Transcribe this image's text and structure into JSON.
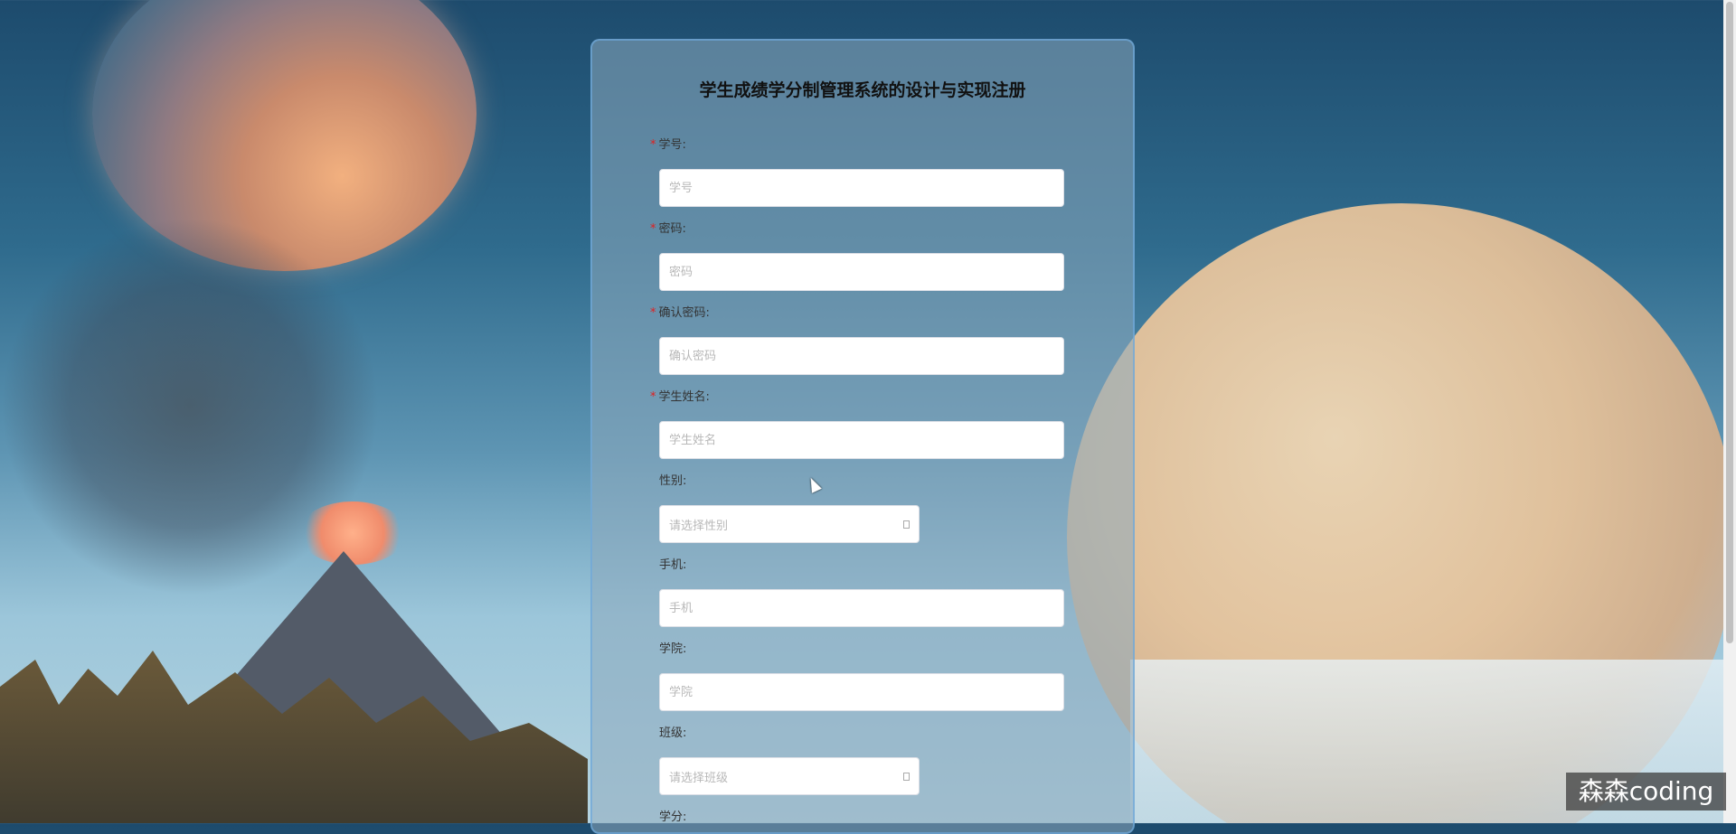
{
  "form": {
    "title": "学生成绩学分制管理系统的设计与实现注册",
    "fields": [
      {
        "label": "学号:",
        "required": true,
        "type": "text",
        "placeholder": "学号"
      },
      {
        "label": "密码:",
        "required": true,
        "type": "password",
        "placeholder": "密码"
      },
      {
        "label": "确认密码:",
        "required": true,
        "type": "password",
        "placeholder": "确认密码"
      },
      {
        "label": "学生姓名:",
        "required": true,
        "type": "text",
        "placeholder": "学生姓名"
      },
      {
        "label": "性别:",
        "required": false,
        "type": "select",
        "placeholder": "请选择性别"
      },
      {
        "label": "手机:",
        "required": false,
        "type": "text",
        "placeholder": "手机"
      },
      {
        "label": "学院:",
        "required": false,
        "type": "text",
        "placeholder": "学院"
      },
      {
        "label": "班级:",
        "required": false,
        "type": "select",
        "placeholder": "请选择班级"
      },
      {
        "label": "学分:",
        "required": false,
        "type": "text",
        "placeholder": ""
      }
    ],
    "required_mark": "*"
  },
  "watermark": "森森coding",
  "icons": {
    "select_arrow": "dropdown-arrow-icon",
    "cursor": "mouse-cursor-icon"
  },
  "colors": {
    "required": "#e02020",
    "card_border": "#6eaadc"
  }
}
